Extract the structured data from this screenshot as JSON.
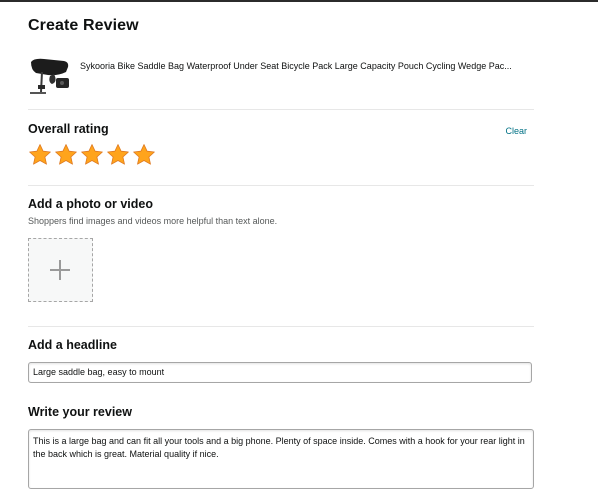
{
  "page": {
    "title": "Create Review"
  },
  "product": {
    "title": "Sykooria Bike Saddle Bag Waterproof Under Seat Bicycle Pack Large Capacity Pouch Cycling Wedge Pac...",
    "image_icon": "saddle-bag-product-image"
  },
  "rating": {
    "title": "Overall rating",
    "clear_label": "Clear",
    "value": 5,
    "max": 5,
    "star_color": "#ffa41c"
  },
  "photo": {
    "title": "Add a photo or video",
    "hint": "Shoppers find images and videos more helpful than text alone.",
    "upload_icon": "plus-icon"
  },
  "headline": {
    "title": "Add a headline",
    "value": "Large saddle bag, easy to mount"
  },
  "review": {
    "title": "Write your review",
    "value": "This is a large bag and can fit all your tools and a big phone. Plenty of space inside. Comes with a hook for your rear light in the back which is great. Material quality if nice."
  },
  "colors": {
    "link": "#007185",
    "divider": "#e7e7e7"
  }
}
